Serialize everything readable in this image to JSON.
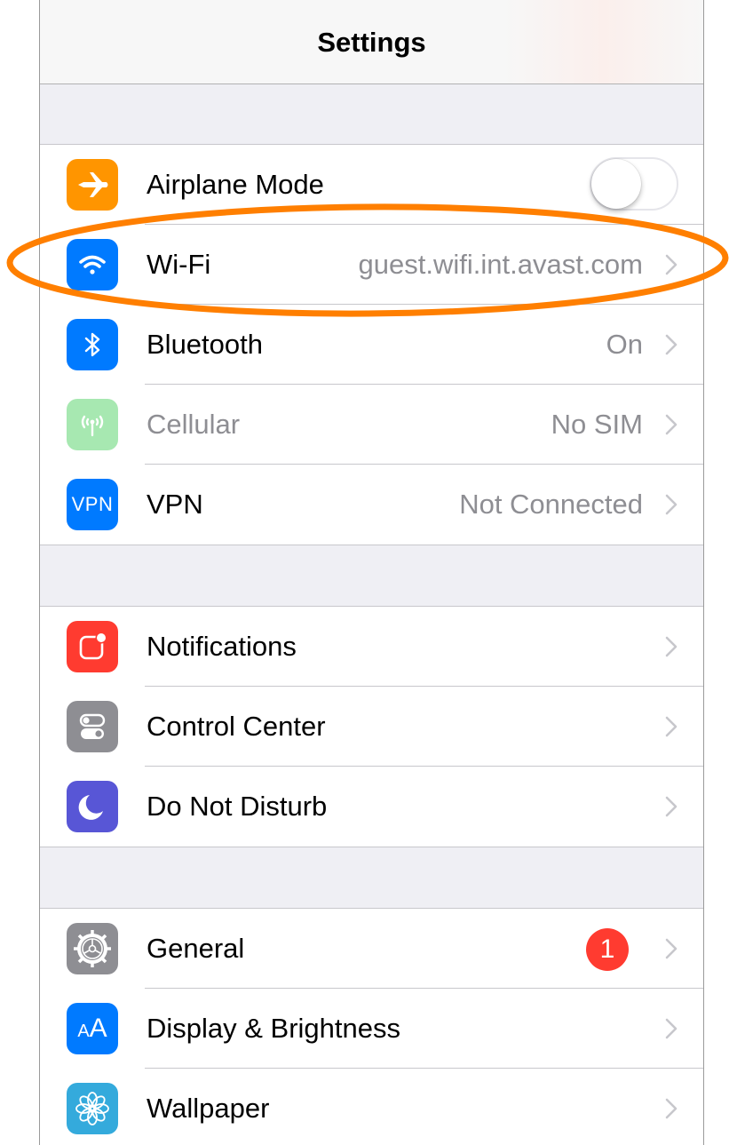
{
  "navbar": {
    "title": "Settings"
  },
  "group1": {
    "airplane": {
      "label": "Airplane Mode",
      "icon": "airplane-icon",
      "color": "#ff9500",
      "toggle_on": false
    },
    "wifi": {
      "label": "Wi-Fi",
      "value": "guest.wifi.int.avast.com",
      "icon": "wifi-icon",
      "color": "#007aff"
    },
    "bluetooth": {
      "label": "Bluetooth",
      "value": "On",
      "icon": "bluetooth-icon",
      "color": "#007aff"
    },
    "cellular": {
      "label": "Cellular",
      "value": "No SIM",
      "icon": "cellular-antenna-icon",
      "color": "#a7e8b1",
      "disabled": true
    },
    "vpn": {
      "label": "VPN",
      "value": "Not Connected",
      "icon_text": "VPN",
      "icon": "vpn-icon",
      "color": "#007aff"
    }
  },
  "group2": {
    "notifications": {
      "label": "Notifications",
      "icon": "notifications-icon",
      "color": "#ff3b30"
    },
    "control_center": {
      "label": "Control Center",
      "icon": "control-center-icon",
      "color": "#8e8e93"
    },
    "dnd": {
      "label": "Do Not Disturb",
      "icon": "moon-icon",
      "color": "#5856d6"
    }
  },
  "group3": {
    "general": {
      "label": "General",
      "badge": "1",
      "icon": "gear-icon",
      "color": "#8e8e93"
    },
    "display": {
      "label": "Display & Brightness",
      "icon_big": "A",
      "icon_small": "A",
      "icon": "display-text-size-icon",
      "color": "#007aff"
    },
    "wallpaper": {
      "label": "Wallpaper",
      "icon": "wallpaper-flower-icon",
      "color": "#34aadc"
    }
  },
  "annotation": {
    "color": "#ff7f00",
    "target": "wifi"
  }
}
